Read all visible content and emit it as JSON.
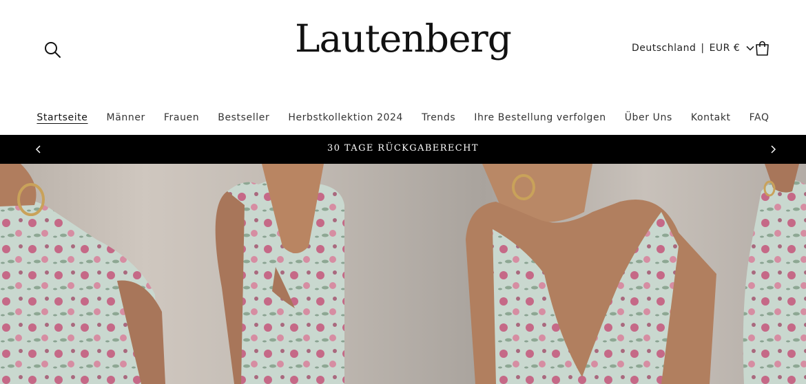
{
  "header": {
    "brand": "Lautenberg",
    "country": "Deutschland",
    "currency": "EUR €",
    "separator": "|"
  },
  "icons": {
    "search": "search-icon",
    "cart": "cart-icon",
    "chevron": "chevron-down-icon",
    "prev": "chevron-left-icon",
    "next": "chevron-right-icon"
  },
  "nav": {
    "items": [
      {
        "label": "Startseite",
        "active": true
      },
      {
        "label": "Männer"
      },
      {
        "label": "Frauen"
      },
      {
        "label": "Bestseller"
      },
      {
        "label": "Herbstkollektion 2024"
      },
      {
        "label": "Trends"
      },
      {
        "label": "Ihre Bestellung verfolgen"
      },
      {
        "label": "Über Uns"
      },
      {
        "label": "Kontakt"
      },
      {
        "label": "FAQ"
      }
    ]
  },
  "announcement": {
    "text": "30 TAGE RÜCKGABERECHT"
  },
  "colors": {
    "announcement_bg": "#000000",
    "dress_mint": "#c9d8cf",
    "floral_pink": "#c4567a"
  }
}
